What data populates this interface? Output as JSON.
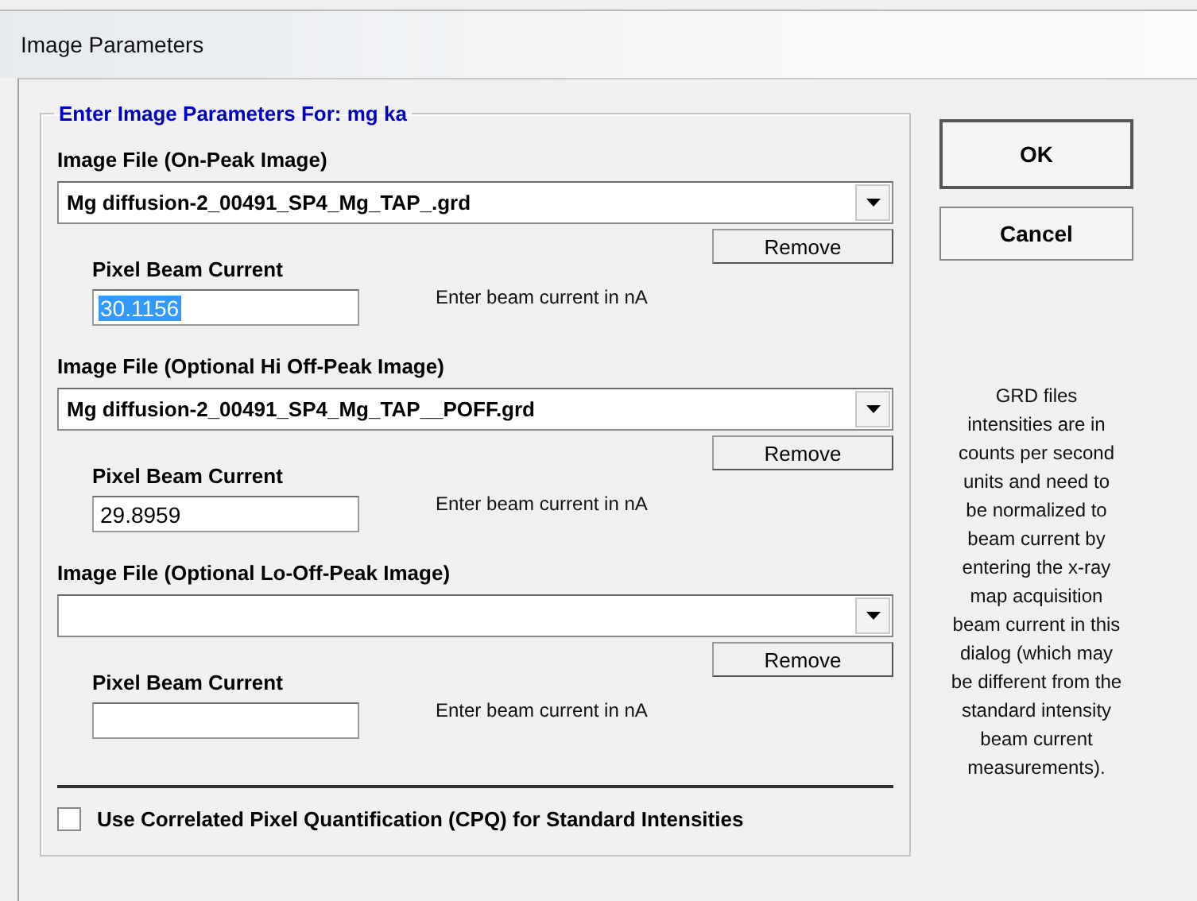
{
  "window": {
    "title": "Image Parameters"
  },
  "group": {
    "title": "Enter Image Parameters For: mg ka"
  },
  "sections": [
    {
      "label": "Image File (On-Peak Image)",
      "file": "Mg diffusion-2_00491_SP4_Mg_TAP_.grd",
      "remove": "Remove",
      "current_label": "Pixel Beam Current",
      "current_value": "30.1156",
      "highlighted": true,
      "hint": "Enter beam current in nA"
    },
    {
      "label": "Image File (Optional Hi Off-Peak Image)",
      "file": "Mg diffusion-2_00491_SP4_Mg_TAP__POFF.grd",
      "remove": "Remove",
      "current_label": "Pixel Beam Current",
      "current_value": "29.8959",
      "highlighted": false,
      "hint": "Enter beam current in nA"
    },
    {
      "label": "Image File (Optional Lo-Off-Peak Image)",
      "remove": "Remove",
      "current_label": "Pixel Beam Current",
      "hint": "Enter beam current in nA"
    }
  ],
  "cpq": {
    "label": "Use Correlated Pixel Quantification (CPQ) for Standard Intensities",
    "checked": false
  },
  "buttons": {
    "ok": "OK",
    "cancel": "Cancel"
  },
  "help_text": "GRD files intensities are in counts per second units and need to be normalized to beam current by entering the x-ray map acquisition beam current in this dialog (which may be different from the standard intensity beam current measurements)."
}
